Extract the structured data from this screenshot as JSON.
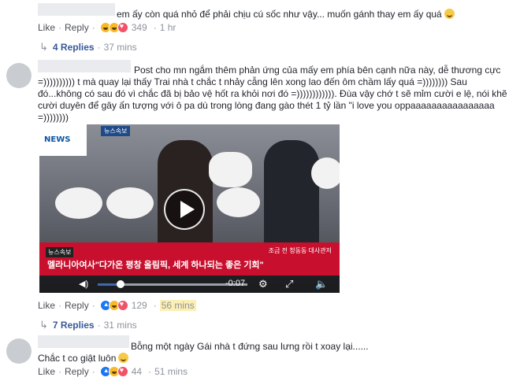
{
  "comments": [
    {
      "text": "em ấy còn quá nhỏ để phải chịu cú sốc như vậy... muốn gánh thay em ấy quá",
      "like": "Like",
      "reply": "Reply",
      "reaction_count": "349",
      "time": "1 hr",
      "replies_label": "4 Replies",
      "replies_time": "37 mins"
    },
    {
      "text": "Post cho mn ngắm thêm phản ứng của mấy em phía bên cạnh nữa này, dễ thương cực =)))))))))) t mà quay lại thấy Trai nhà t chắc t nhảy cẫng lên xong lao đến ôm chầm lấy quá =)))))))) Sau đó...không có sau đó vì chắc đã bị bảo vệ hốt ra khỏi nơi đó =)))))))))))). Đùa vậy chớ t sẽ mỉm cười e lệ, nói khẽ cười duyên để gây ấn tượng với ô pa dù trong lòng đang gào thét 1 tỷ lần \"i love you oppaaaaaaaaaaaaaaaa =))))))))",
      "like": "Like",
      "reply": "Reply",
      "reaction_count": "129",
      "time": "56 mins",
      "replies_label": "7 Replies",
      "replies_time": "31 mins",
      "video": {
        "channel_logo": "NEWS",
        "tag": "뉴스속보",
        "badge": "뉴스속보",
        "caption": "조금 전 청동동 대사관저",
        "subtitle": "멜라니아여사\"다가온 평창 올림픽, 세계 하나되는 좋은 기회\"",
        "time_remaining": "-0:07"
      }
    },
    {
      "text_line1": "Bỗng một ngày Gái nhà t đứng sau lưng rồi t xoay lại......",
      "text_line2": "Chắc t co giật luôn",
      "like": "Like",
      "reply": "Reply",
      "reaction_count": "44",
      "time": "51 mins"
    }
  ],
  "colors": {
    "link": "#385898",
    "meta": "#8d949e",
    "text": "#1d2129",
    "highlight": "#fcefb4"
  }
}
